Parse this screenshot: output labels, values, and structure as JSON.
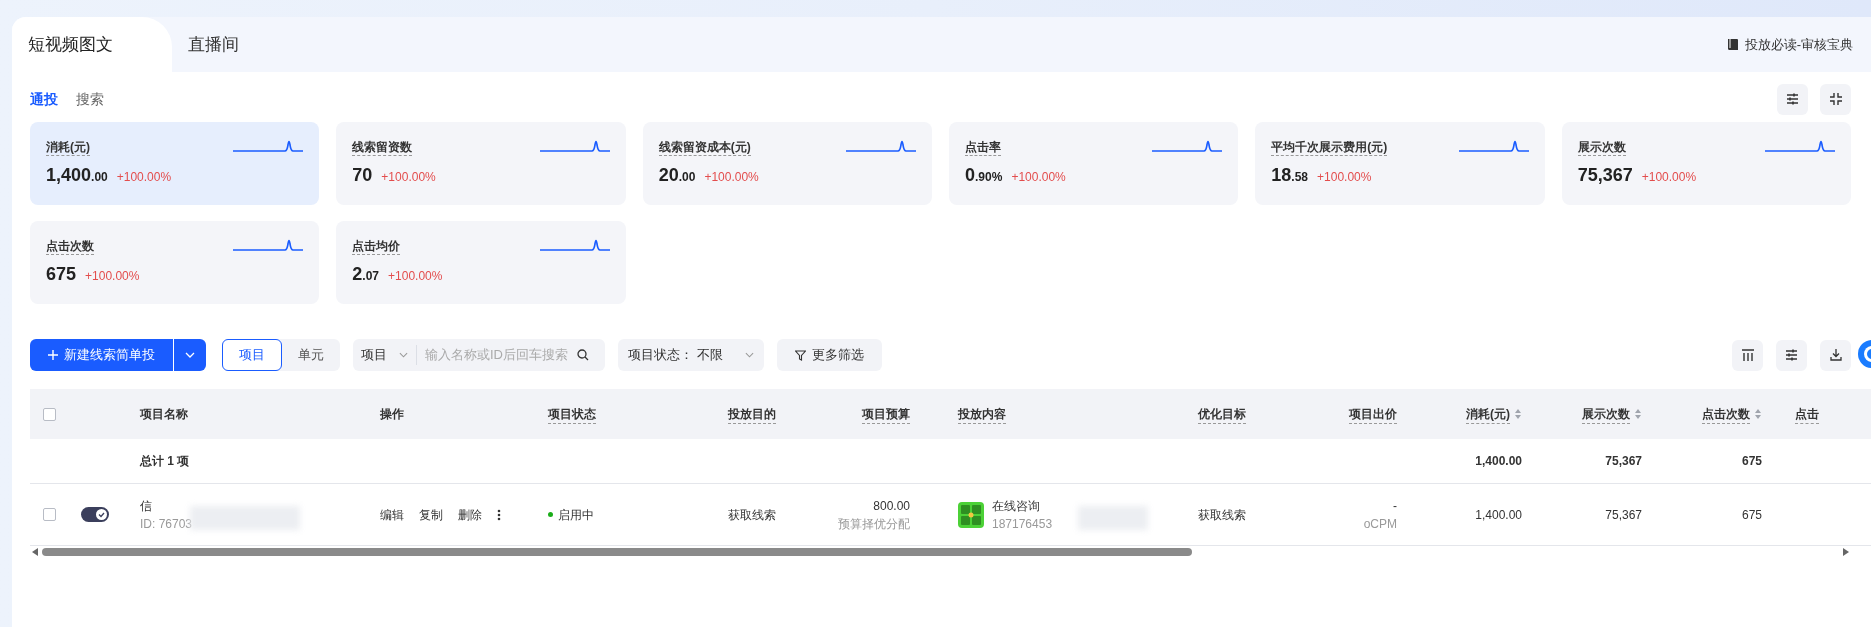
{
  "top_tabs": [
    {
      "label": "短视频图文",
      "selected": true
    },
    {
      "label": "直播间",
      "selected": false
    }
  ],
  "guide_link": "投放必读-审核宝典",
  "sub_tabs": [
    {
      "label": "通投",
      "selected": true
    },
    {
      "label": "搜索",
      "selected": false
    }
  ],
  "metrics": [
    {
      "label": "消耗(元)",
      "integer": "1,400",
      "decimal": ".00",
      "change": "+100.00%",
      "selected": true
    },
    {
      "label": "线索留资数",
      "integer": "70",
      "change": "+100.00%",
      "selected": false
    },
    {
      "label": "线索留资成本(元)",
      "integer": "20",
      "decimal": ".00",
      "change": "+100.00%",
      "selected": false
    },
    {
      "label": "点击率",
      "integer": "0",
      "decimal": ".90%",
      "change": "+100.00%",
      "selected": false
    },
    {
      "label": "平均千次展示费用(元)",
      "integer": "18",
      "decimal": ".58",
      "change": "+100.00%",
      "selected": false
    },
    {
      "label": "展示次数",
      "integer": "75,367",
      "change": "+100.00%",
      "selected": false
    },
    {
      "label": "点击次数",
      "integer": "675",
      "change": "+100.00%",
      "selected": false
    },
    {
      "label": "点击均价",
      "integer": "2",
      "decimal": ".07",
      "change": "+100.00%",
      "selected": false
    }
  ],
  "toolbar": {
    "create_button": "新建线索简单投",
    "level_toggle": [
      {
        "label": "项目",
        "selected": true
      },
      {
        "label": "单元",
        "selected": false
      }
    ],
    "search": {
      "scope": "项目",
      "placeholder": "输入名称或ID后回车搜索"
    },
    "status_filter": {
      "label": "项目状态：",
      "value": "不限"
    },
    "more_filters": "更多筛选"
  },
  "table": {
    "all_checked": false,
    "columns": [
      {
        "label": "项目名称",
        "hint": false,
        "sortable": false
      },
      {
        "label": "操作",
        "hint": false,
        "sortable": false
      },
      {
        "label": "项目状态",
        "hint": true,
        "sortable": false
      },
      {
        "label": "投放目的",
        "hint": true,
        "sortable": false
      },
      {
        "label": "项目预算",
        "hint": true,
        "sortable": false
      },
      {
        "label": "投放内容",
        "hint": true,
        "sortable": false
      },
      {
        "label": "优化目标",
        "hint": true,
        "sortable": false
      },
      {
        "label": "项目出价",
        "hint": true,
        "sortable": false
      },
      {
        "label": "消耗(元)",
        "hint": true,
        "sortable": true
      },
      {
        "label": "展示次数",
        "hint": true,
        "sortable": true
      },
      {
        "label": "点击次数",
        "hint": true,
        "sortable": true
      },
      {
        "label": "点击",
        "hint": true,
        "sortable": false
      }
    ],
    "total_row": {
      "label": "总计 1 项",
      "cost": "1,400.00",
      "impressions": "75,367",
      "clicks": "675"
    },
    "rows": [
      {
        "checked": false,
        "on": true,
        "name": "信",
        "id": "ID: 76703",
        "actions": [
          "编辑",
          "复制",
          "删除"
        ],
        "status": "启用中",
        "purpose": "获取线索",
        "budget": "800.00",
        "budget_note": "预算择优分配",
        "content_title": "在线咨询",
        "content_id": "187176453",
        "target": "获取线索",
        "bid": "-",
        "bid_type": "oCPM",
        "cost": "1,400.00",
        "impressions": "75,367",
        "clicks": "675"
      }
    ]
  }
}
